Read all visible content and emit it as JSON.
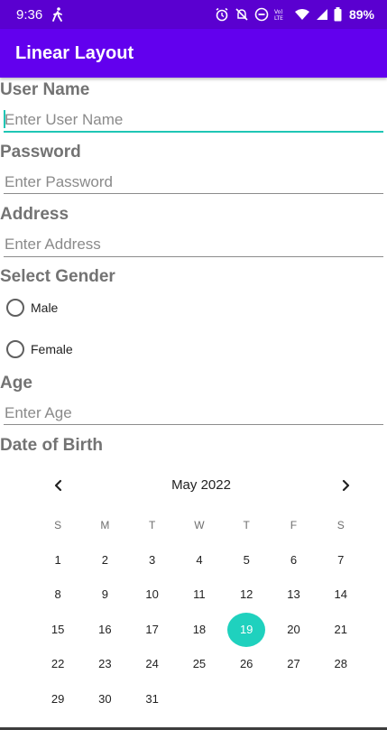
{
  "status_bar": {
    "time": "9:36",
    "battery": "89%",
    "icons": [
      "walking-icon",
      "alarm-icon",
      "mute-icon",
      "dnd-icon",
      "volte-icon",
      "wifi-icon",
      "signal-icon",
      "battery-icon"
    ]
  },
  "app_bar": {
    "title": "Linear Layout",
    "color": "#6200ee"
  },
  "form": {
    "user_name": {
      "label": "User Name",
      "placeholder": "Enter User Name"
    },
    "password": {
      "label": "Password",
      "placeholder": "Enter Password"
    },
    "address": {
      "label": "Address",
      "placeholder": "Enter Address"
    },
    "gender": {
      "label": "Select Gender",
      "options": [
        "Male",
        "Female"
      ]
    },
    "age": {
      "label": "Age",
      "placeholder": "Enter Age"
    },
    "dob": {
      "label": "Date of Birth"
    }
  },
  "calendar": {
    "month_title": "May 2022",
    "days_of_week": [
      "S",
      "M",
      "T",
      "W",
      "T",
      "F",
      "S"
    ],
    "weeks": [
      [
        "1",
        "2",
        "3",
        "4",
        "5",
        "6",
        "7"
      ],
      [
        "8",
        "9",
        "10",
        "11",
        "12",
        "13",
        "14"
      ],
      [
        "15",
        "16",
        "17",
        "18",
        "19",
        "20",
        "21"
      ],
      [
        "22",
        "23",
        "24",
        "25",
        "26",
        "27",
        "28"
      ],
      [
        "29",
        "30",
        "31",
        "",
        "",
        "",
        ""
      ]
    ],
    "selected_day": "19",
    "accent_color": "#1fd1be"
  }
}
